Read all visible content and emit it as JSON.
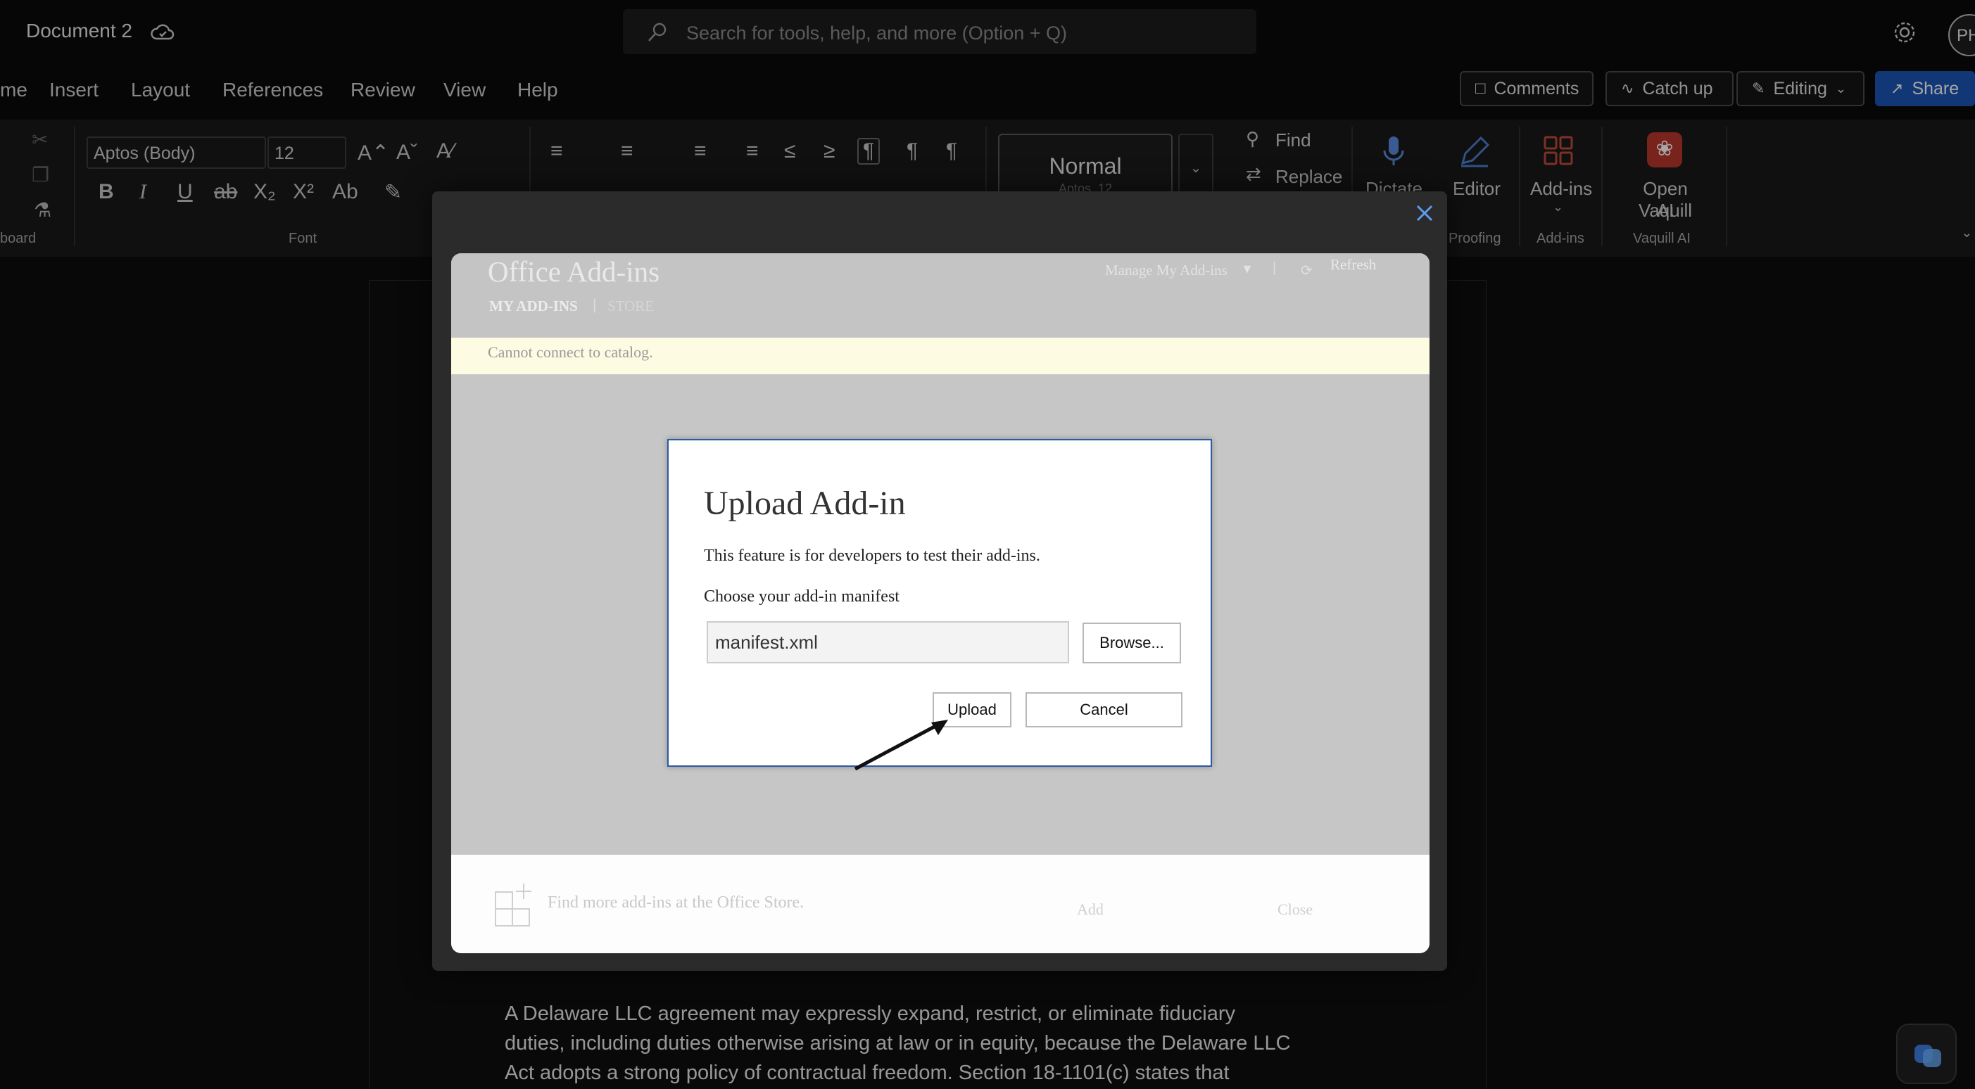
{
  "titlebar": {
    "doc_title": "Document 2",
    "search_placeholder": "Search for tools, help, and more (Option + Q)",
    "avatar_initials": "PH"
  },
  "menu": {
    "items": [
      "me",
      "Insert",
      "Layout",
      "References",
      "Review",
      "View",
      "Help"
    ],
    "comments": "Comments",
    "catch_up": "Catch up",
    "editing": "Editing",
    "share": "Share"
  },
  "ribbon": {
    "font_name": "Aptos (Body)",
    "font_size": "12",
    "style_name": "Normal",
    "style_sub": "Aptos, 12",
    "find": "Find",
    "replace": "Replace",
    "dictate": "Dictate",
    "editor": "Editor",
    "addins": "Add-ins",
    "open_vaquill_1": "Open Vaquill",
    "open_vaquill_2": "AI",
    "groups": {
      "clipboard": "board",
      "font": "Font",
      "proofing": "Proofing",
      "addins": "Add-ins",
      "vaquill": "Vaquill AI"
    }
  },
  "office_addins": {
    "title": "Office Add-ins",
    "tab_my": "MY ADD-INS",
    "tab_sep": "|",
    "tab_store": "STORE",
    "manage": "Manage My Add-ins",
    "pipe": "|",
    "refresh": "Refresh",
    "catalog_message": "Cannot connect to catalog.",
    "store_text": "Find more add-ins at the Office Store.",
    "add": "Add",
    "close": "Close"
  },
  "upload_dialog": {
    "title": "Upload Add-in",
    "description": "This feature is for developers to test their add-ins.",
    "manifest_label": "Choose your add-in manifest",
    "manifest_value": "manifest.xml",
    "browse": "Browse...",
    "upload": "Upload",
    "cancel": "Cancel"
  },
  "document": {
    "line1": "A Delaware LLC agreement may expressly expand, restrict, or eliminate fiduciary",
    "line2": "duties, including duties otherwise arising at law or in equity, because the Delaware LLC",
    "line3": "Act adopts a strong policy of contractual freedom. Section 18-1101(c) states that"
  },
  "colors": {
    "share_blue": "#1c55b5",
    "dialog_border": "#2b5aa6",
    "catalog_bar": "#fefbe3"
  }
}
